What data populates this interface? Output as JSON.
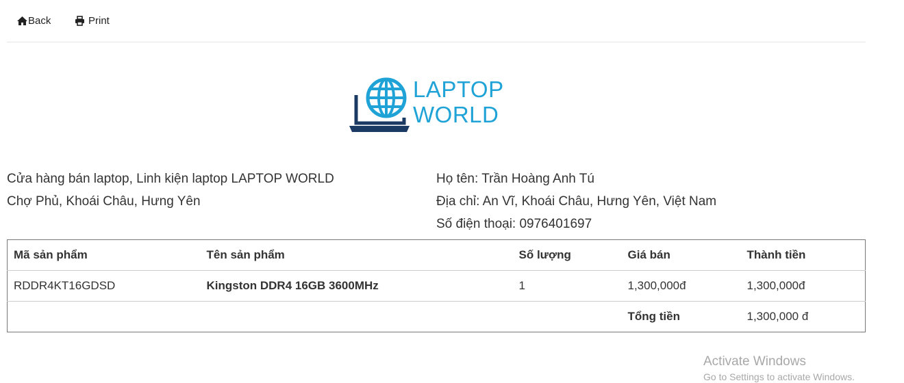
{
  "toolbar": {
    "back_label": "Back",
    "print_label": "Print"
  },
  "logo": {
    "line1": "LAPTOP",
    "line2": "WORLD",
    "color": "#1fa3d7",
    "icon_color": "#1b3a63"
  },
  "store": {
    "name": "Cửa hàng bán laptop, Linh kiện laptop LAPTOP WORLD",
    "address": "Chợ Phủ, Khoái Châu, Hưng Yên"
  },
  "customer": {
    "name_line": "Họ tên: Trần Hoàng Anh Tú",
    "address_line": "Địa chỉ: An Vĩ, Khoái Châu, Hưng Yên, Việt Nam",
    "phone_line": "Số điện thoại: 0976401697"
  },
  "table": {
    "headers": [
      "Mã sản phẩm",
      "Tên sản phẩm",
      "Số lượng",
      "Giá bán",
      "Thành tiền"
    ],
    "rows": [
      {
        "code": "RDDR4KT16GDSD",
        "name": "Kingston DDR4 16GB 3600MHz",
        "qty": "1",
        "price": "1,300,000đ",
        "subtotal": "1,300,000đ"
      }
    ],
    "total_label": "Tổng tiền",
    "total_value": "1,300,000 đ"
  },
  "watermark": {
    "line1": "Activate Windows",
    "line2": "Go to Settings to activate Windows."
  }
}
